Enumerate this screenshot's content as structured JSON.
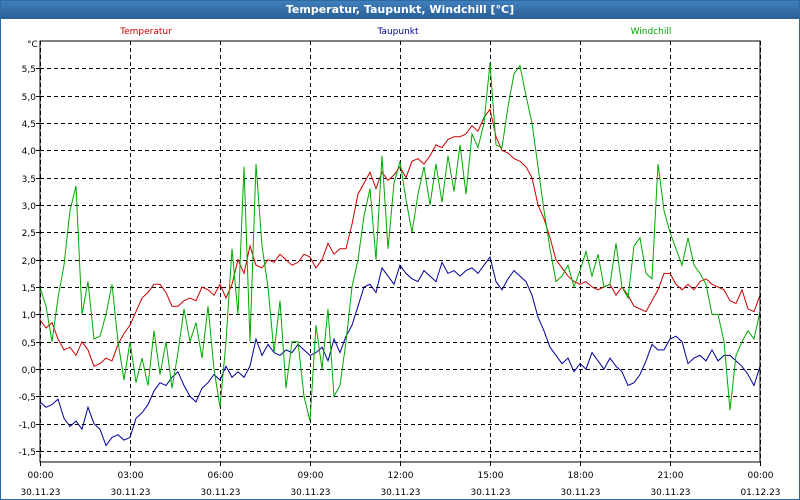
{
  "window": {
    "title": "Temperatur, Taupunkt, Windchill [°C]"
  },
  "chart_data": {
    "type": "line",
    "title": "Temperatur, Taupunkt, Windchill [°C]",
    "ylabel": "°C",
    "ylim": [
      -1.7,
      6.0
    ],
    "xlim": [
      0,
      24
    ],
    "grid": true,
    "yticks": [
      -1.5,
      -1.0,
      -0.5,
      0.0,
      0.5,
      1.0,
      1.5,
      2.0,
      2.5,
      3.0,
      3.5,
      4.0,
      4.5,
      5.0,
      5.5
    ],
    "ytick_labels": [
      "-1,5",
      "-1,0",
      "-0,5",
      "0,0",
      "0,5",
      "1,0",
      "1,5",
      "2,0",
      "2,5",
      "3,0",
      "3,5",
      "4,0",
      "4,5",
      "5,0",
      "5,5"
    ],
    "xticks": [
      {
        "x": 0,
        "time": "00:00",
        "date": "30.11.23"
      },
      {
        "x": 3,
        "time": "03:00",
        "date": "30.11.23"
      },
      {
        "x": 6,
        "time": "06:00",
        "date": "30.11.23"
      },
      {
        "x": 9,
        "time": "09:00",
        "date": "30.11.23"
      },
      {
        "x": 12,
        "time": "12:00",
        "date": "30.11.23"
      },
      {
        "x": 15,
        "time": "15:00",
        "date": "30.11.23"
      },
      {
        "x": 18,
        "time": "18:00",
        "date": "30.11.23"
      },
      {
        "x": 21,
        "time": "21:00",
        "date": "30.11.23"
      },
      {
        "x": 24,
        "time": "00:00",
        "date": "01.12.23"
      }
    ],
    "series": [
      {
        "name": "Temperatur",
        "color": "#cc0000",
        "x": [
          0,
          0.2,
          0.4,
          0.6,
          0.8,
          1.0,
          1.2,
          1.4,
          1.6,
          1.8,
          2.0,
          2.2,
          2.4,
          2.6,
          2.8,
          3.0,
          3.2,
          3.4,
          3.6,
          3.8,
          4.0,
          4.2,
          4.4,
          4.6,
          4.8,
          5.0,
          5.2,
          5.4,
          5.6,
          5.8,
          6.0,
          6.2,
          6.4,
          6.6,
          6.8,
          7.0,
          7.2,
          7.4,
          7.6,
          7.8,
          8.0,
          8.2,
          8.4,
          8.6,
          8.8,
          9.0,
          9.2,
          9.4,
          9.6,
          9.8,
          10.0,
          10.2,
          10.4,
          10.6,
          10.8,
          11.0,
          11.2,
          11.4,
          11.6,
          11.8,
          12.0,
          12.2,
          12.4,
          12.6,
          12.8,
          13.0,
          13.2,
          13.4,
          13.6,
          13.8,
          14.0,
          14.2,
          14.4,
          14.6,
          14.8,
          15.0,
          15.2,
          15.4,
          15.6,
          15.8,
          16.0,
          16.2,
          16.4,
          16.6,
          16.8,
          17.0,
          17.2,
          17.4,
          17.6,
          17.8,
          18.0,
          18.2,
          18.4,
          18.6,
          18.8,
          19.0,
          19.2,
          19.4,
          19.6,
          19.8,
          20.0,
          20.2,
          20.4,
          20.6,
          20.8,
          21.0,
          21.2,
          21.4,
          21.6,
          21.8,
          22.0,
          22.2,
          22.4,
          22.6,
          22.8,
          23.0,
          23.2,
          23.4,
          23.6,
          23.8,
          24.0
        ],
        "values": [
          0.9,
          0.75,
          0.85,
          0.55,
          0.35,
          0.4,
          0.25,
          0.5,
          0.35,
          0.05,
          0.1,
          0.2,
          0.15,
          0.45,
          0.65,
          0.8,
          1.05,
          1.3,
          1.4,
          1.55,
          1.55,
          1.4,
          1.15,
          1.15,
          1.25,
          1.3,
          1.25,
          1.5,
          1.45,
          1.35,
          1.55,
          1.3,
          1.55,
          2.0,
          1.75,
          2.25,
          1.9,
          1.85,
          2.0,
          1.95,
          2.1,
          2.0,
          1.9,
          1.95,
          2.1,
          2.05,
          1.85,
          2.0,
          2.3,
          2.1,
          2.2,
          2.2,
          2.65,
          3.2,
          3.4,
          3.6,
          3.3,
          3.6,
          3.45,
          3.55,
          3.7,
          3.5,
          3.8,
          3.85,
          3.75,
          3.9,
          4.1,
          4.05,
          4.2,
          4.25,
          4.25,
          4.3,
          4.45,
          4.35,
          4.6,
          4.75,
          4.25,
          4.0,
          3.95,
          3.85,
          3.8,
          3.7,
          3.5,
          3.0,
          2.75,
          2.4,
          2.0,
          1.85,
          1.7,
          1.6,
          1.55,
          1.6,
          1.5,
          1.45,
          1.5,
          1.55,
          1.35,
          1.5,
          1.35,
          1.15,
          1.1,
          1.05,
          1.25,
          1.45,
          1.75,
          1.75,
          1.55,
          1.45,
          1.55,
          1.45,
          1.6,
          1.65,
          1.55,
          1.5,
          1.45,
          1.25,
          1.2,
          1.45,
          1.1,
          1.05,
          1.35
        ]
      },
      {
        "name": "Taupunkt",
        "color": "#000099",
        "x": [
          0,
          0.2,
          0.4,
          0.6,
          0.8,
          1.0,
          1.2,
          1.4,
          1.6,
          1.8,
          2.0,
          2.2,
          2.4,
          2.6,
          2.8,
          3.0,
          3.2,
          3.4,
          3.6,
          3.8,
          4.0,
          4.2,
          4.4,
          4.6,
          4.8,
          5.0,
          5.2,
          5.4,
          5.6,
          5.8,
          6.0,
          6.2,
          6.4,
          6.6,
          6.8,
          7.0,
          7.2,
          7.4,
          7.6,
          7.8,
          8.0,
          8.2,
          8.4,
          8.6,
          8.8,
          9.0,
          9.2,
          9.4,
          9.6,
          9.8,
          10.0,
          10.2,
          10.4,
          10.6,
          10.8,
          11.0,
          11.2,
          11.4,
          11.6,
          11.8,
          12.0,
          12.2,
          12.4,
          12.6,
          12.8,
          13.0,
          13.2,
          13.4,
          13.6,
          13.8,
          14.0,
          14.2,
          14.4,
          14.6,
          14.8,
          15.0,
          15.2,
          15.4,
          15.6,
          15.8,
          16.0,
          16.2,
          16.4,
          16.6,
          16.8,
          17.0,
          17.2,
          17.4,
          17.6,
          17.8,
          18.0,
          18.2,
          18.4,
          18.6,
          18.8,
          19.0,
          19.2,
          19.4,
          19.6,
          19.8,
          20.0,
          20.2,
          20.4,
          20.6,
          20.8,
          21.0,
          21.2,
          21.4,
          21.6,
          21.8,
          22.0,
          22.2,
          22.4,
          22.6,
          22.8,
          23.0,
          23.2,
          23.4,
          23.6,
          23.8,
          24.0
        ],
        "values": [
          -0.6,
          -0.7,
          -0.65,
          -0.55,
          -0.9,
          -1.05,
          -0.95,
          -1.1,
          -0.7,
          -1.0,
          -1.1,
          -1.4,
          -1.25,
          -1.2,
          -1.3,
          -1.25,
          -0.9,
          -0.8,
          -0.65,
          -0.4,
          -0.25,
          -0.3,
          -0.15,
          -0.05,
          -0.3,
          -0.5,
          -0.6,
          -0.35,
          -0.25,
          -0.1,
          -0.2,
          0.05,
          -0.15,
          -0.05,
          -0.15,
          0.05,
          0.55,
          0.25,
          0.45,
          0.3,
          0.25,
          0.35,
          0.3,
          0.45,
          0.35,
          0.25,
          0.3,
          0.4,
          0.15,
          0.55,
          0.3,
          0.6,
          0.8,
          1.15,
          1.5,
          1.55,
          1.4,
          1.85,
          1.7,
          1.55,
          1.9,
          1.75,
          1.65,
          1.6,
          1.8,
          1.7,
          1.6,
          1.95,
          1.75,
          1.8,
          1.7,
          1.8,
          1.85,
          1.75,
          1.9,
          2.05,
          1.6,
          1.45,
          1.65,
          1.8,
          1.7,
          1.6,
          1.35,
          0.95,
          0.7,
          0.4,
          0.25,
          0.1,
          0.2,
          -0.05,
          0.1,
          0.0,
          0.3,
          0.15,
          0.0,
          0.2,
          0.05,
          -0.05,
          -0.3,
          -0.25,
          -0.1,
          0.15,
          0.45,
          0.35,
          0.35,
          0.55,
          0.6,
          0.5,
          0.1,
          0.2,
          0.25,
          0.15,
          0.35,
          0.15,
          0.25,
          0.25,
          0.15,
          0.05,
          -0.1,
          -0.3,
          0.05
        ]
      },
      {
        "name": "Windchill",
        "color": "#00aa00",
        "x": [
          0,
          0.2,
          0.4,
          0.6,
          0.8,
          1.0,
          1.2,
          1.4,
          1.6,
          1.8,
          2.0,
          2.2,
          2.4,
          2.6,
          2.8,
          3.0,
          3.2,
          3.4,
          3.6,
          3.8,
          4.0,
          4.2,
          4.4,
          4.6,
          4.8,
          5.0,
          5.2,
          5.4,
          5.6,
          5.8,
          6.0,
          6.2,
          6.4,
          6.6,
          6.8,
          7.0,
          7.2,
          7.4,
          7.6,
          7.8,
          8.0,
          8.2,
          8.4,
          8.6,
          8.8,
          9.0,
          9.2,
          9.4,
          9.6,
          9.8,
          10.0,
          10.2,
          10.4,
          10.6,
          10.8,
          11.0,
          11.2,
          11.4,
          11.6,
          11.8,
          12.0,
          12.2,
          12.4,
          12.6,
          12.8,
          13.0,
          13.2,
          13.4,
          13.6,
          13.8,
          14.0,
          14.2,
          14.4,
          14.6,
          14.8,
          15.0,
          15.2,
          15.4,
          15.6,
          15.8,
          16.0,
          16.2,
          16.4,
          16.6,
          16.8,
          17.0,
          17.2,
          17.4,
          17.6,
          17.8,
          18.0,
          18.2,
          18.4,
          18.6,
          18.8,
          19.0,
          19.2,
          19.4,
          19.6,
          19.8,
          20.0,
          20.2,
          20.4,
          20.6,
          20.8,
          21.0,
          21.2,
          21.4,
          21.6,
          21.8,
          22.0,
          22.2,
          22.4,
          22.6,
          22.8,
          23.0,
          23.2,
          23.4,
          23.6,
          23.8,
          24.0
        ],
        "values": [
          1.5,
          1.15,
          0.5,
          1.3,
          1.9,
          2.9,
          3.35,
          1.0,
          1.6,
          0.55,
          0.6,
          1.0,
          1.55,
          0.5,
          -0.2,
          0.5,
          -0.25,
          0.2,
          -0.3,
          0.7,
          -0.1,
          0.5,
          -0.35,
          0.3,
          1.1,
          0.5,
          0.85,
          0.2,
          1.15,
          0.0,
          -0.7,
          0.5,
          2.2,
          1.0,
          3.7,
          0.5,
          3.75,
          2.25,
          1.5,
          0.3,
          1.25,
          -0.35,
          0.5,
          0.5,
          -0.5,
          -0.95,
          0.8,
          0.0,
          1.1,
          -0.5,
          -0.3,
          0.5,
          1.5,
          2.0,
          2.8,
          3.3,
          2.0,
          3.9,
          2.2,
          3.4,
          3.8,
          3.1,
          2.5,
          3.2,
          3.7,
          3.0,
          3.75,
          3.05,
          3.9,
          3.25,
          4.1,
          3.2,
          4.3,
          4.05,
          4.5,
          5.6,
          4.1,
          4.05,
          4.8,
          5.4,
          5.55,
          5.0,
          4.5,
          3.7,
          2.9,
          2.2,
          1.6,
          1.7,
          1.9,
          1.5,
          1.8,
          2.15,
          1.7,
          2.1,
          1.5,
          1.55,
          2.3,
          1.5,
          1.3,
          2.25,
          2.4,
          1.75,
          1.65,
          3.75,
          2.9,
          2.5,
          2.2,
          1.9,
          2.4,
          1.9,
          1.75,
          1.55,
          1.0,
          1.0,
          0.5,
          -0.75,
          0.25,
          0.5,
          0.7,
          0.55,
          1.05
        ]
      }
    ]
  }
}
